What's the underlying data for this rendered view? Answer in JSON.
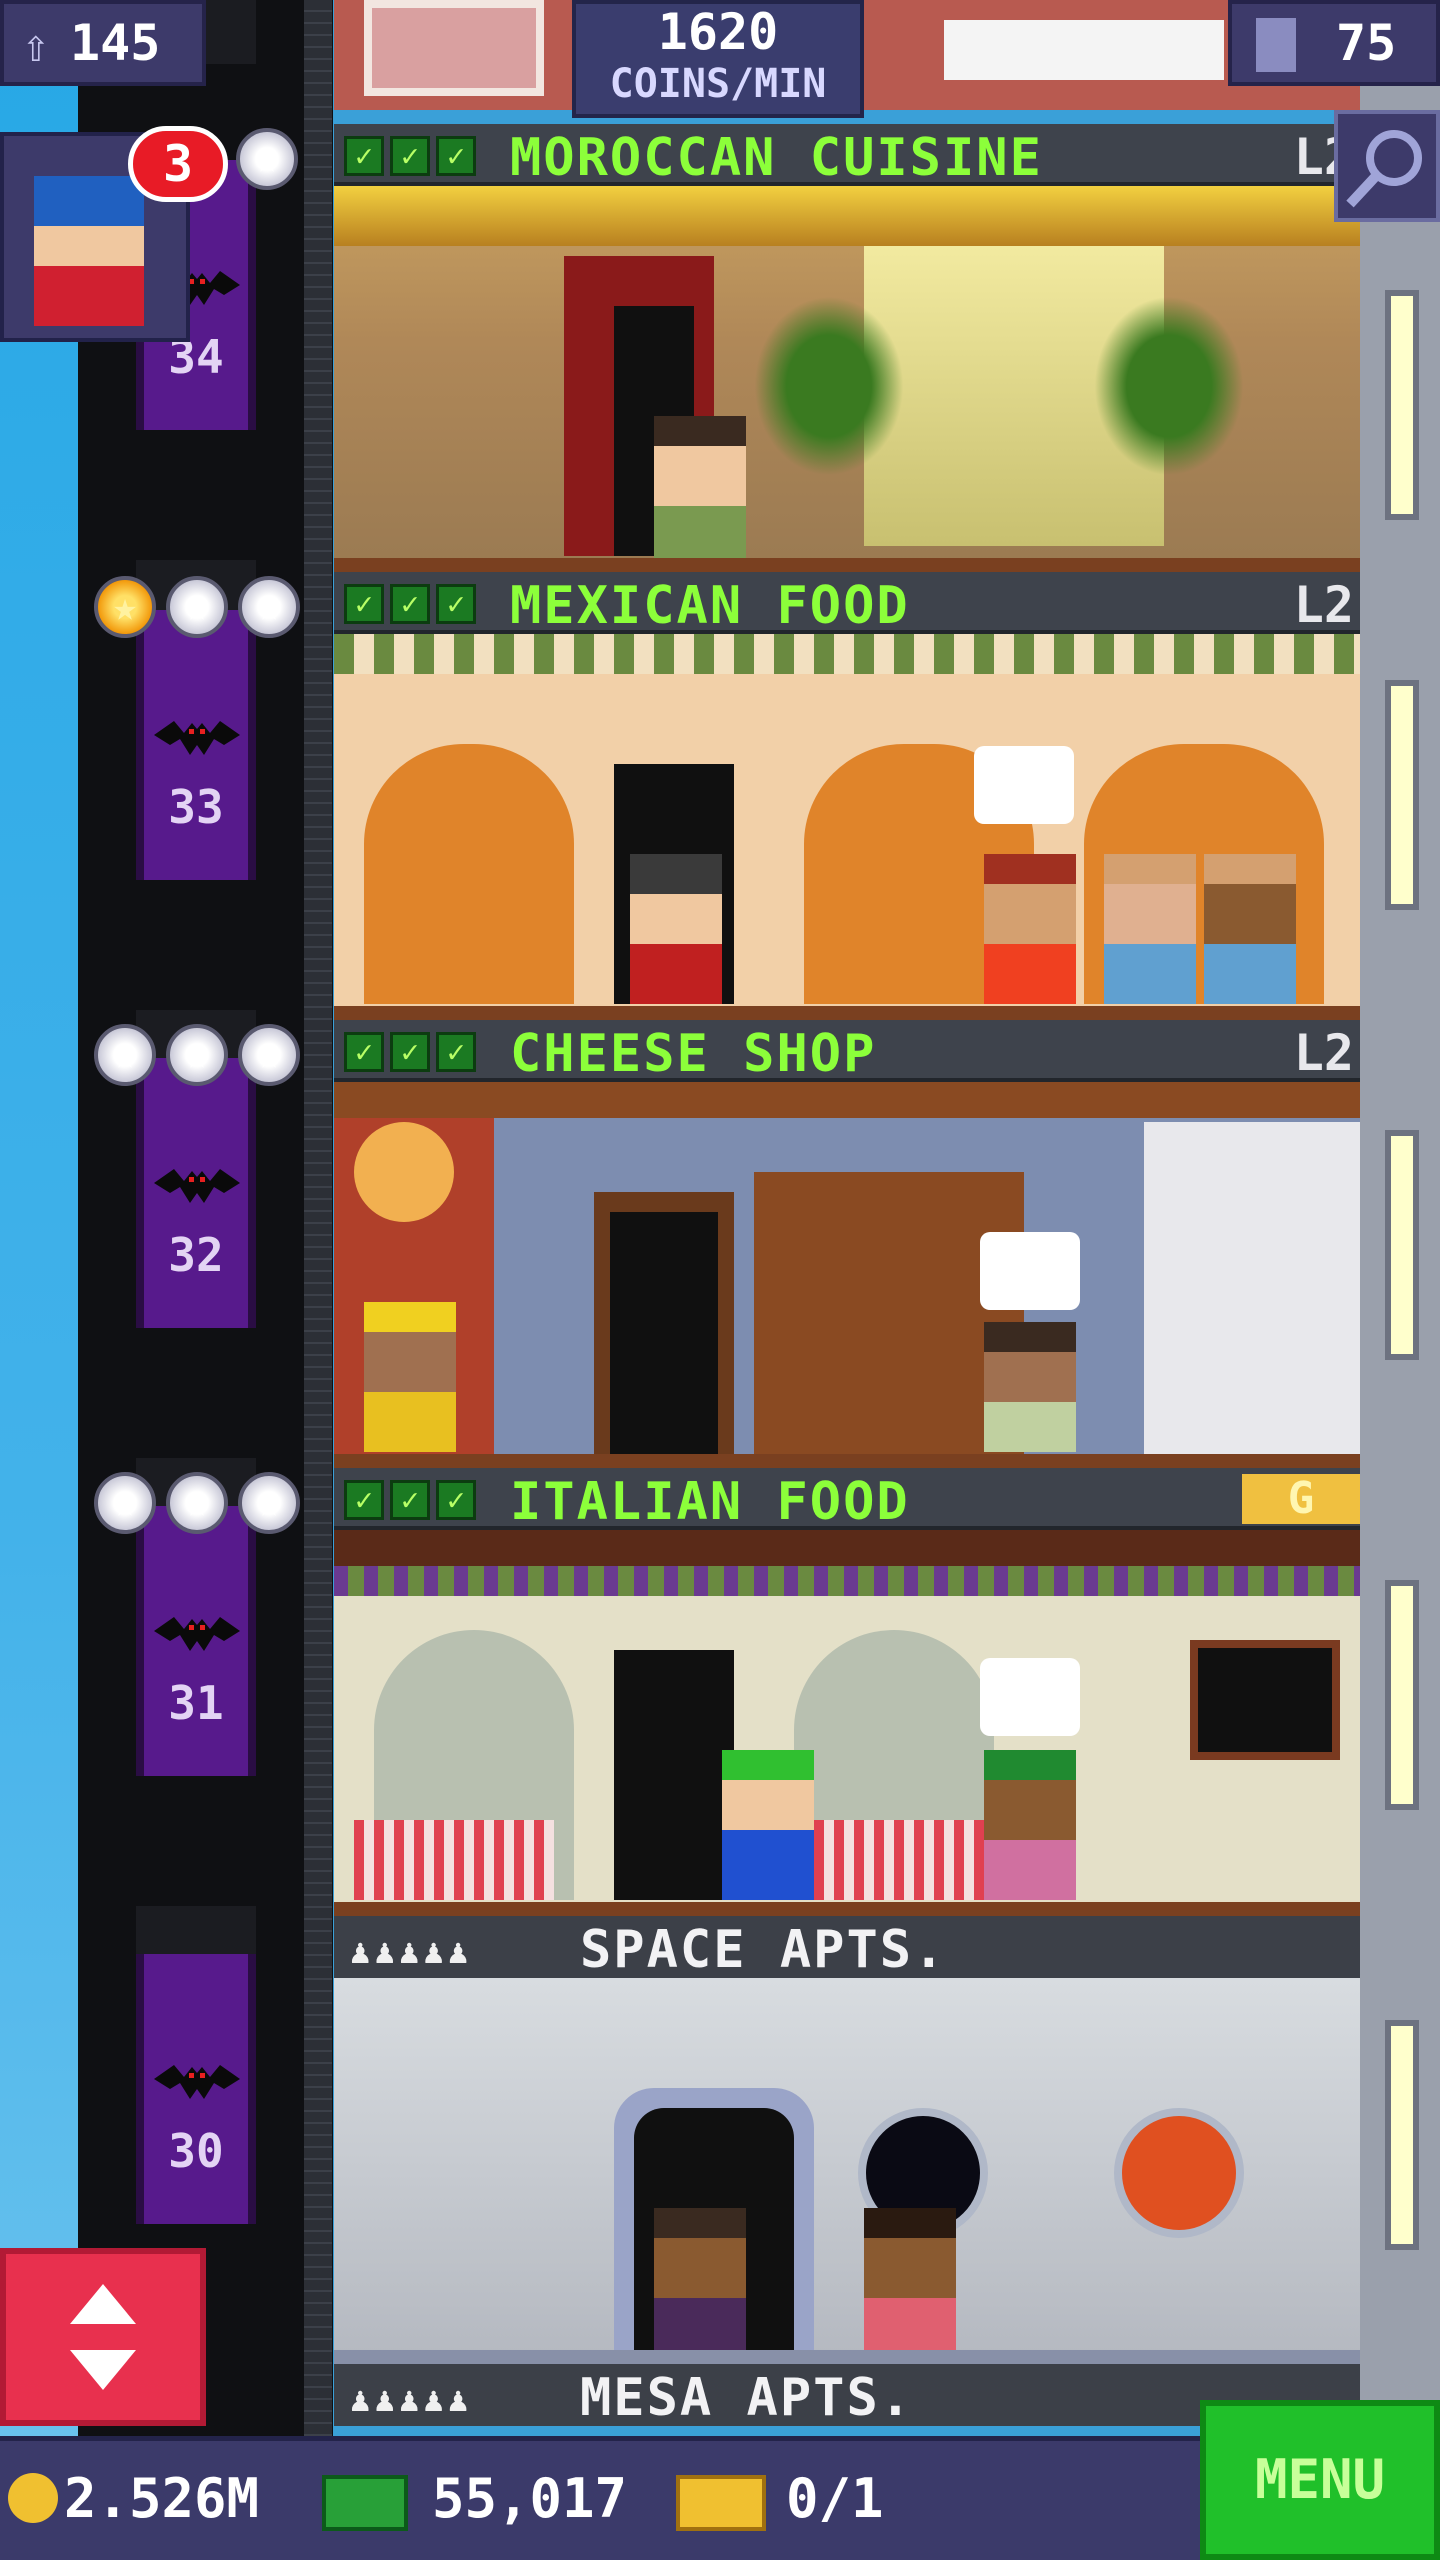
{
  "hud": {
    "population": "145",
    "coins_per_min": "1620",
    "coins_per_min_unit": "COINS/MIN",
    "floor_count": "75",
    "vip_count": "3",
    "coins": "2.526M",
    "bux": "55,017",
    "tickets": "0/1",
    "menu_label": "MENU"
  },
  "colors": {
    "accent_green": "#8cff3a",
    "hud_purple": "#3d3a6a",
    "elevator_purple": "#571a8c",
    "menu_green": "#20c02a",
    "elevator_button_red": "#e8304e"
  },
  "floors": [
    {
      "name": "MOROCCAN CUISINE",
      "level": "L2",
      "elevator_floor": "34",
      "checks": 3,
      "stars_gold": 0
    },
    {
      "name": "MEXICAN FOOD",
      "level": "L2",
      "elevator_floor": "33",
      "checks": 3,
      "stars_gold": 1
    },
    {
      "name": "CHEESE SHOP",
      "level": "L2",
      "elevator_floor": "32",
      "checks": 3,
      "stars_gold": 0
    },
    {
      "name": "ITALIAN FOOD",
      "level": "G",
      "elevator_floor": "31",
      "checks": 3,
      "stars_gold": 0
    },
    {
      "name": "SPACE APTS.",
      "level": "",
      "elevator_floor": "30",
      "residents": 5
    },
    {
      "name": "MESA APTS.",
      "level": "",
      "residents": 5
    }
  ],
  "icons": {
    "population": "person-up-icon",
    "floors": "building-icon",
    "search": "magnifier-icon",
    "coin": "coin-icon",
    "bux": "bux-icon",
    "ticket": "ticket-icon",
    "elevator": "up-down-arrows-icon"
  }
}
